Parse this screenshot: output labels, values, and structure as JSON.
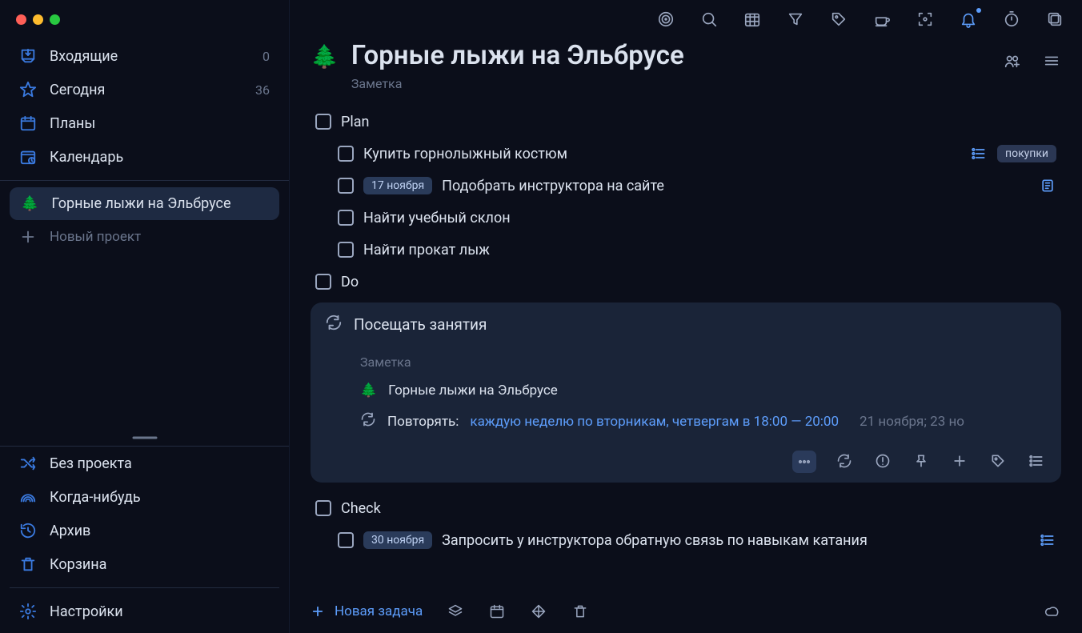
{
  "sidebar": {
    "main": [
      {
        "icon": "inbox",
        "label": "Входящие",
        "count": "0"
      },
      {
        "icon": "star",
        "label": "Сегодня",
        "count": "36"
      },
      {
        "icon": "plans",
        "label": "Планы",
        "count": ""
      },
      {
        "icon": "calendar",
        "label": "Календарь",
        "count": ""
      }
    ],
    "project_emoji": "🌲",
    "project_label": "Горные лыжи на Эльбрусе",
    "new_project": "Новый проект",
    "system": [
      {
        "icon": "shuffle",
        "label": "Без проекта"
      },
      {
        "icon": "rainbow",
        "label": "Когда-нибудь"
      },
      {
        "icon": "archive",
        "label": "Архив"
      },
      {
        "icon": "trash",
        "label": "Корзина"
      }
    ],
    "settings": "Настройки"
  },
  "header": {
    "emoji": "🌲",
    "title": "Горные лыжи на Эльбрусе",
    "subtitle": "Заметка"
  },
  "tasks": {
    "plan_label": "Plan",
    "plan_items": [
      {
        "title": "Купить горнолыжный костюм",
        "date": "",
        "tag": "покупки",
        "icon": "subtasks"
      },
      {
        "title": "Подобрать инструктора на сайте",
        "date": "17 ноября",
        "tag": "",
        "icon": "note"
      },
      {
        "title": "Найти учебный склон",
        "date": "",
        "tag": "",
        "icon": ""
      },
      {
        "title": "Найти прокат лыж",
        "date": "",
        "tag": "",
        "icon": ""
      }
    ],
    "do_label": "Do",
    "card": {
      "title": "Посещать занятия",
      "note": "Заметка",
      "project_emoji": "🌲",
      "project": "Горные лыжи на Эльбрусе",
      "repeat_label": "Повторять:",
      "repeat_value": "каждую неделю по вторникам, четвергам в 18:00 — 20:00",
      "repeat_next": "21 ноября; 23 но"
    },
    "check_label": "Check",
    "check_items": [
      {
        "title": "Запросить у инструктора обратную связь по навыкам катания",
        "date": "30 ноября",
        "icon": "subtasks"
      }
    ]
  },
  "bottom": {
    "add_task": "Новая задача"
  }
}
